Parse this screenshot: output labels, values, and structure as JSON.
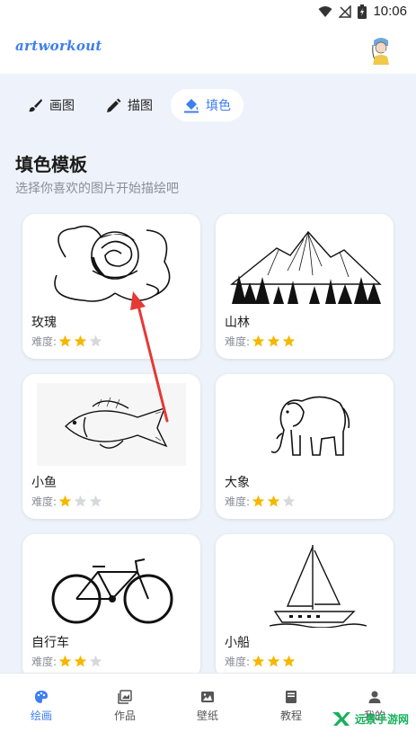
{
  "status_bar": {
    "time": "10:06"
  },
  "header": {
    "logo_text": "artworkout"
  },
  "tabs": [
    {
      "label": "画图",
      "icon": "brush-icon",
      "active": false
    },
    {
      "label": "描图",
      "icon": "pencil-icon",
      "active": false
    },
    {
      "label": "填色",
      "icon": "paint-bucket-icon",
      "active": true
    }
  ],
  "section": {
    "title": "填色模板",
    "subtitle": "选择你喜欢的图片开始描绘吧"
  },
  "difficulty_label": "难度:",
  "cards": [
    {
      "name": "玫瑰",
      "difficulty": 2,
      "max": 3,
      "image": "rose-drawing"
    },
    {
      "name": "山林",
      "difficulty": 3,
      "max": 3,
      "image": "mountain-forest-drawing"
    },
    {
      "name": "小鱼",
      "difficulty": 1,
      "max": 3,
      "image": "fish-drawing"
    },
    {
      "name": "大象",
      "difficulty": 2,
      "max": 3,
      "image": "elephant-drawing"
    },
    {
      "name": "自行车",
      "difficulty": 2,
      "max": 3,
      "image": "bicycle-drawing"
    },
    {
      "name": "小船",
      "difficulty": 3,
      "max": 3,
      "image": "sailboat-drawing"
    }
  ],
  "bottom_nav": [
    {
      "label": "绘画",
      "icon": "palette-icon",
      "active": true
    },
    {
      "label": "作品",
      "icon": "gallery-icon",
      "active": false
    },
    {
      "label": "壁纸",
      "icon": "image-icon",
      "active": false
    },
    {
      "label": "教程",
      "icon": "book-icon",
      "active": false
    },
    {
      "label": "我的",
      "icon": "person-icon",
      "active": false
    }
  ],
  "watermark": {
    "text": "远景手游网"
  },
  "colors": {
    "accent": "#3d7ef0",
    "star_on": "#f5b800",
    "star_off": "#d6d8dc",
    "annotation_arrow": "#e53935",
    "watermark": "#15b15a"
  }
}
